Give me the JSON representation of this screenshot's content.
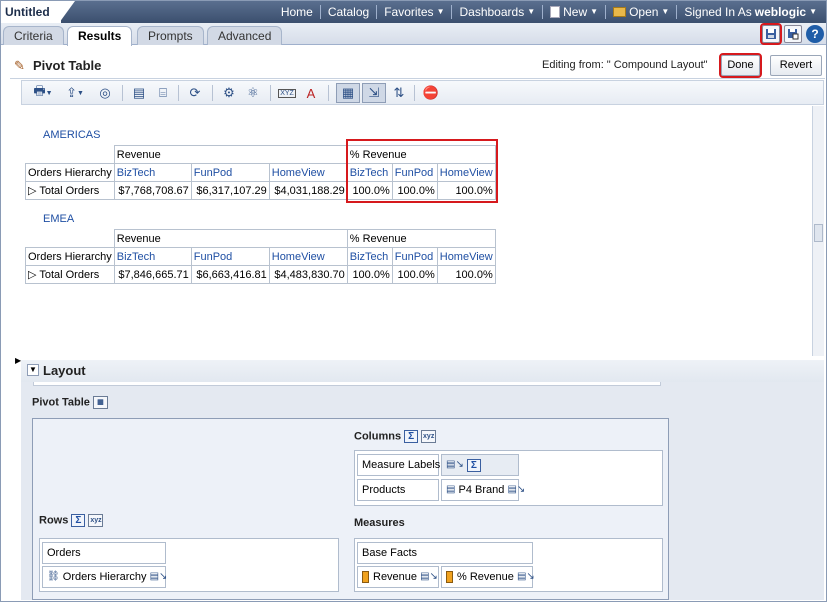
{
  "app": {
    "title": "Untitled"
  },
  "nav": {
    "home": "Home",
    "catalog": "Catalog",
    "favorites": "Favorites",
    "dashboards": "Dashboards",
    "new": "New",
    "open": "Open",
    "signed_in_as": "Signed In As",
    "user": "weblogic"
  },
  "tabs": [
    "Criteria",
    "Results",
    "Prompts",
    "Advanced"
  ],
  "header": {
    "title": "Pivot Table",
    "editing_from": "Editing from: \" Compound Layout\"",
    "done": "Done",
    "revert": "Revert"
  },
  "icons": {
    "save": "save-icon",
    "save_as": "save-as-icon",
    "help": "help-icon",
    "help_glyph": "?"
  },
  "pivot": {
    "americas": {
      "region": "AMERICAS",
      "measure1": "Revenue",
      "measure2": "% Revenue",
      "row_header": "Orders Hierarchy",
      "brands": [
        "BizTech",
        "FunPod",
        "HomeView"
      ],
      "row_label": "Total Orders",
      "revenue": [
        "$7,768,708.67",
        "$6,317,107.29",
        "$4,031,188.29"
      ],
      "pct": [
        "100.0%",
        "100.0%",
        "100.0%"
      ]
    },
    "emea": {
      "region": "EMEA",
      "measure1": "Revenue",
      "measure2": "% Revenue",
      "row_header": "Orders Hierarchy",
      "brands": [
        "BizTech",
        "FunPod",
        "HomeView"
      ],
      "row_label": "Total Orders",
      "revenue": [
        "$7,846,665.71",
        "$6,663,416.81",
        "$4,483,830.70"
      ],
      "pct": [
        "100.0%",
        "100.0%",
        "100.0%"
      ]
    }
  },
  "layout": {
    "title": "Layout",
    "pivot_table_label": "Pivot Table",
    "columns_label": "Columns",
    "rows_label": "Rows",
    "measures_label": "Measures",
    "columns": {
      "measure_labels": "Measure Labels",
      "products": "Products",
      "p4_brand": "P4 Brand"
    },
    "rows": {
      "orders": "Orders",
      "orders_hierarchy": "Orders Hierarchy"
    },
    "measures": {
      "base_facts": "Base Facts",
      "revenue": "Revenue",
      "pct_revenue": "% Revenue"
    }
  }
}
